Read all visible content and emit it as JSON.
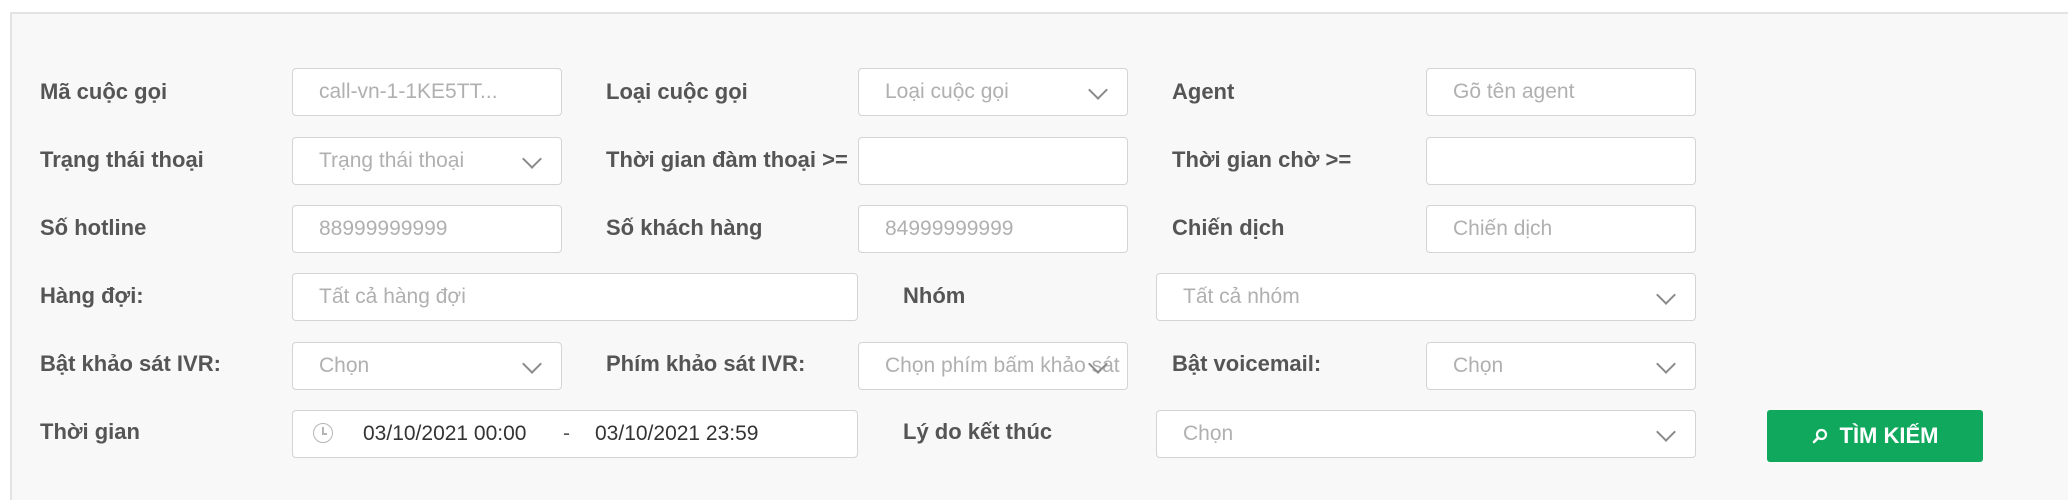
{
  "labels": {
    "call_id": "Mã cuộc gọi",
    "call_type": "Loại cuộc gọi",
    "agent": "Agent",
    "call_status": "Trạng thái thoại",
    "talk_time": "Thời gian đàm thoại >=",
    "wait_time": "Thời gian chờ >=",
    "hotline": "Số hotline",
    "customer_number": "Số khách hàng",
    "campaign": "Chiến dịch",
    "queue": "Hàng đợi:",
    "group": "Nhóm",
    "ivr_survey": "Bật khảo sát IVR:",
    "ivr_key": "Phím khảo sát IVR:",
    "voicemail": "Bật voicemail:",
    "time": "Thời gian",
    "end_reason": "Lý do kết thúc"
  },
  "fields": {
    "call_id_placeholder": "call-vn-1-1KE5TT...",
    "call_type_placeholder": "Loại cuộc gọi",
    "agent_placeholder": "Gõ tên agent",
    "call_status_placeholder": "Trạng thái thoại",
    "talk_time_value": "",
    "wait_time_value": "",
    "hotline_placeholder": "88999999999",
    "customer_number_placeholder": "84999999999",
    "campaign_placeholder": "Chiến dịch",
    "queue_placeholder": "Tất cả hàng đợi",
    "group_placeholder": "Tất cả nhóm",
    "ivr_survey_placeholder": "Chọn",
    "ivr_key_placeholder": "Chọn phím bấm khảo sát",
    "voicemail_placeholder": "Chọn",
    "time_start": "03/10/2021 00:00",
    "time_separator": "-",
    "time_end": "03/10/2021 23:59",
    "end_reason_placeholder": "Chọn"
  },
  "search_button": {
    "label": "TÌM KIẾM",
    "icon": "search-icon",
    "color": "#10a85c"
  }
}
